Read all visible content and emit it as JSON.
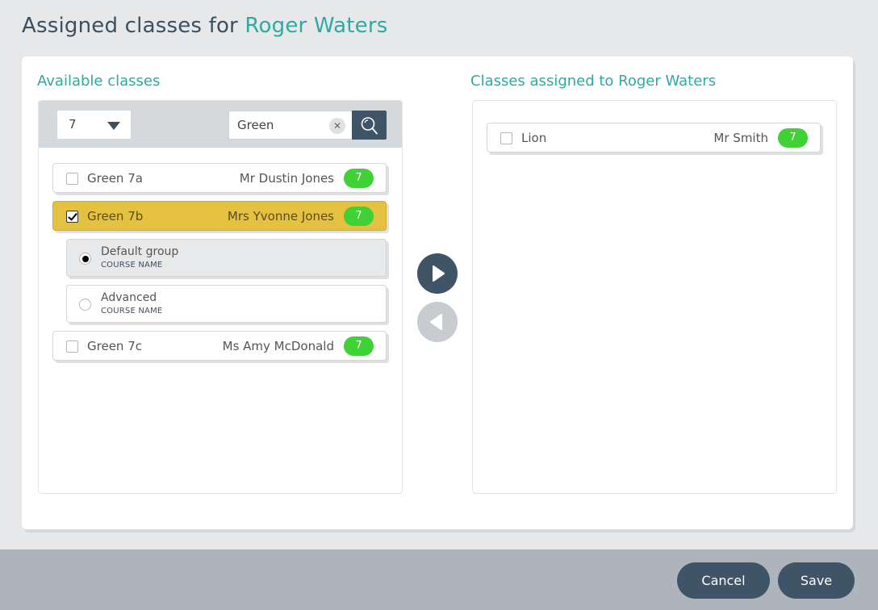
{
  "header": {
    "title_prefix": "Assigned classes for",
    "student_name": "Roger Waters"
  },
  "available": {
    "title": "Available classes",
    "year_filter": {
      "selected": "7"
    },
    "search": {
      "value": "Green",
      "placeholder": ""
    },
    "classes": [
      {
        "name": "Green 7a",
        "teacher": "Mr Dustin Jones",
        "year": "7",
        "checked": false
      },
      {
        "name": "Green 7b",
        "teacher": "Mrs Yvonne Jones",
        "year": "7",
        "checked": true,
        "groups": [
          {
            "name": "Default group",
            "subtitle": "COURSE NAME",
            "selected": true
          },
          {
            "name": "Advanced",
            "subtitle": "COURSE NAME",
            "selected": false
          }
        ]
      },
      {
        "name": "Green 7c",
        "teacher": "Ms Amy McDonald",
        "year": "7",
        "checked": false
      }
    ]
  },
  "assigned": {
    "title": "Classes assigned to Roger Waters",
    "classes": [
      {
        "name": "Lion",
        "teacher": "Mr Smith",
        "year": "7",
        "checked": false
      }
    ]
  },
  "transfer": {
    "add_icon": "play-right-icon",
    "remove_icon": "play-left-icon"
  },
  "footer": {
    "cancel_label": "Cancel",
    "save_label": "Save"
  },
  "colors": {
    "accent": "#30a9a0",
    "primary": "#3f5567",
    "selected_row": "#e5c141",
    "badge": "#3fd136"
  }
}
